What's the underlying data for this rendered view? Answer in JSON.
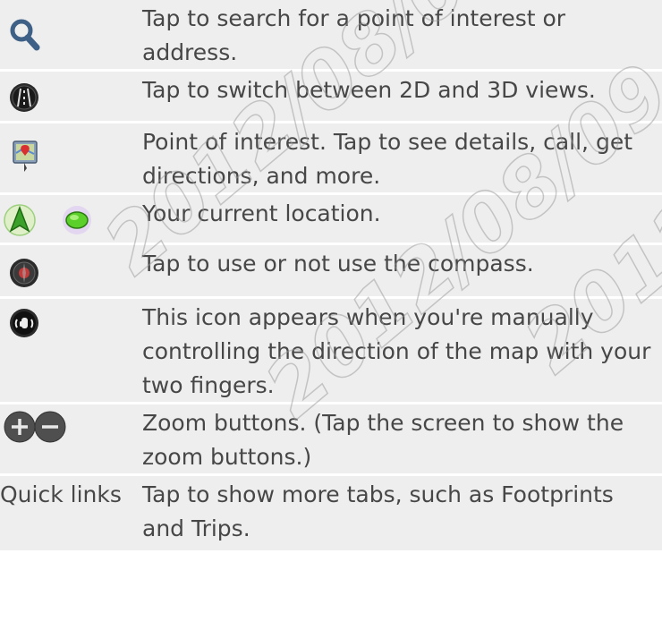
{
  "rows": [
    {
      "icon": "search-icon",
      "description": "Tap to search for a point of interest or address."
    },
    {
      "icon": "view-2d-3d-icon",
      "description": "Tap to switch between 2D and 3D views."
    },
    {
      "icon": "point-of-interest-icon",
      "description": "Point of interest. Tap to see details, call, get directions, and more."
    },
    {
      "icon": "current-location-icon",
      "description": "Your current location."
    },
    {
      "icon": "compass-icon",
      "description": "Tap to use or not use the compass."
    },
    {
      "icon": "manual-direction-icon",
      "description": "This icon appears when you're manually controlling the direction of the map with your two fingers."
    },
    {
      "icon": "zoom-buttons-icon",
      "description": "Zoom buttons. (Tap the screen to show the zoom buttons.)"
    },
    {
      "label": "Quick links",
      "description": "Tap to show more tabs, such as Footprints and Trips."
    }
  ],
  "watermark": [
    "2012/08/09",
    "2012/08/09",
    "2012/08/09"
  ],
  "colors": {
    "row_bg": "#eeeeee",
    "text": "#474747",
    "icon_blue": "#3a5f86"
  }
}
